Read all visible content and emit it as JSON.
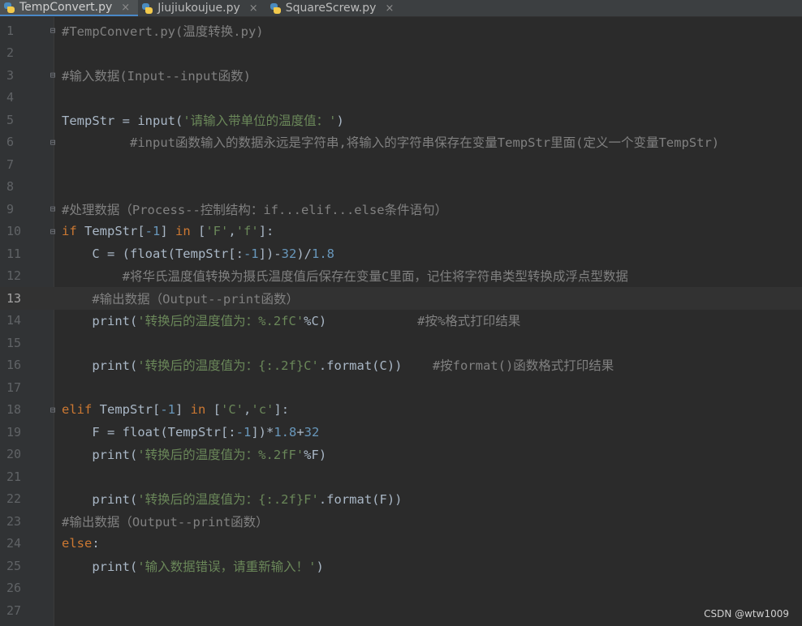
{
  "tabs": [
    {
      "label": "TempConvert.py",
      "active": true
    },
    {
      "label": "Jiujiukoujue.py",
      "active": false
    },
    {
      "label": "SquareScrew.py",
      "active": false
    }
  ],
  "close_glyph": "×",
  "current_line": 13,
  "lines": [
    {
      "n": "1",
      "fold": "⊟",
      "tokens": [
        [
          "cm",
          "#TempConvert.py(温度转换.py)"
        ]
      ]
    },
    {
      "n": "2",
      "fold": "",
      "tokens": []
    },
    {
      "n": "3",
      "fold": "⊟",
      "tokens": [
        [
          "cm",
          "#输入数据(Input--input函数)"
        ]
      ]
    },
    {
      "n": "4",
      "fold": "",
      "tokens": []
    },
    {
      "n": "5",
      "fold": "",
      "tokens": [
        [
          "tx",
          "TempStr = input("
        ],
        [
          "st",
          "'请输入带单位的温度值：'"
        ],
        [
          "tx",
          ")"
        ]
      ]
    },
    {
      "n": "6",
      "fold": "⊟",
      "tokens": [
        [
          "cm",
          "         #input函数输入的数据永远是字符串,将输入的字符串保存在变量TempStr里面(定义一个变量TempStr)"
        ]
      ]
    },
    {
      "n": "7",
      "fold": "",
      "tokens": []
    },
    {
      "n": "8",
      "fold": "",
      "tokens": []
    },
    {
      "n": "9",
      "fold": "⊟",
      "tokens": [
        [
          "cm",
          "#处理数据（Process--控制结构：if...elif...else条件语句）"
        ]
      ]
    },
    {
      "n": "10",
      "fold": "⊟",
      "tokens": [
        [
          "kw",
          "if "
        ],
        [
          "tx",
          "TempStr["
        ],
        [
          "nm",
          "-1"
        ],
        [
          "tx",
          "] "
        ],
        [
          "kw",
          "in "
        ],
        [
          "tx",
          "["
        ],
        [
          "st",
          "'F'"
        ],
        [
          "tx",
          ","
        ],
        [
          "st",
          "'f'"
        ],
        [
          "tx",
          "]:"
        ]
      ]
    },
    {
      "n": "11",
      "fold": "",
      "tokens": [
        [
          "tx",
          "    C = (float(TempStr[:"
        ],
        [
          "nm",
          "-1"
        ],
        [
          "tx",
          "])-"
        ],
        [
          "nm",
          "32"
        ],
        [
          "tx",
          ")/"
        ],
        [
          "nm",
          "1.8"
        ]
      ]
    },
    {
      "n": "12",
      "fold": "",
      "tokens": [
        [
          "cm",
          "        #将华氏温度值转换为摄氏温度值后保存在变量C里面，记住将字符串类型转换成浮点型数据"
        ]
      ]
    },
    {
      "n": "13",
      "fold": "",
      "tokens": [
        [
          "cm",
          "    #输出数据（Output--print函数）"
        ]
      ]
    },
    {
      "n": "14",
      "fold": "",
      "tokens": [
        [
          "tx",
          "    print("
        ],
        [
          "st",
          "'转换后的温度值为：%.2fC'"
        ],
        [
          "tx",
          "%C)            "
        ],
        [
          "cm",
          "#按%格式打印结果"
        ]
      ]
    },
    {
      "n": "15",
      "fold": "",
      "tokens": []
    },
    {
      "n": "16",
      "fold": "",
      "tokens": [
        [
          "tx",
          "    print("
        ],
        [
          "st",
          "'转换后的温度值为：{:.2f}C'"
        ],
        [
          "tx",
          ".format(C))    "
        ],
        [
          "cm",
          "#按format()函数格式打印结果"
        ]
      ]
    },
    {
      "n": "17",
      "fold": "",
      "tokens": []
    },
    {
      "n": "18",
      "fold": "⊟",
      "tokens": [
        [
          "kw",
          "elif "
        ],
        [
          "tx",
          "TempStr["
        ],
        [
          "nm",
          "-1"
        ],
        [
          "tx",
          "] "
        ],
        [
          "kw",
          "in "
        ],
        [
          "tx",
          "["
        ],
        [
          "st",
          "'C'"
        ],
        [
          "tx",
          ","
        ],
        [
          "st",
          "'c'"
        ],
        [
          "tx",
          "]:"
        ]
      ]
    },
    {
      "n": "19",
      "fold": "",
      "tokens": [
        [
          "tx",
          "    F = float(TempStr[:"
        ],
        [
          "nm",
          "-1"
        ],
        [
          "tx",
          "])*"
        ],
        [
          "nm",
          "1.8"
        ],
        [
          "tx",
          "+"
        ],
        [
          "nm",
          "32"
        ]
      ]
    },
    {
      "n": "20",
      "fold": "",
      "tokens": [
        [
          "tx",
          "    print("
        ],
        [
          "st",
          "'转换后的温度值为：%.2fF'"
        ],
        [
          "tx",
          "%F)"
        ]
      ]
    },
    {
      "n": "21",
      "fold": "",
      "tokens": []
    },
    {
      "n": "22",
      "fold": "",
      "tokens": [
        [
          "tx",
          "    print("
        ],
        [
          "st",
          "'转换后的温度值为：{:.2f}F'"
        ],
        [
          "tx",
          ".format(F))"
        ]
      ]
    },
    {
      "n": "23",
      "fold": "",
      "tokens": [
        [
          "cm",
          "#输出数据（Output--print函数）"
        ]
      ]
    },
    {
      "n": "24",
      "fold": "",
      "tokens": [
        [
          "kw",
          "else"
        ],
        [
          "tx",
          ":"
        ]
      ]
    },
    {
      "n": "25",
      "fold": "",
      "tokens": [
        [
          "tx",
          "    print("
        ],
        [
          "st",
          "'输入数据错误，请重新输入！'"
        ],
        [
          "tx",
          ")"
        ]
      ]
    },
    {
      "n": "26",
      "fold": "",
      "tokens": []
    },
    {
      "n": "27",
      "fold": "",
      "tokens": []
    }
  ],
  "watermark": "CSDN @wtw1009",
  "colors": {
    "background": "#2b2b2b",
    "comment": "#808080",
    "keyword": "#cc7832",
    "string": "#6a8759",
    "number": "#6897bb",
    "text": "#a9b7c6"
  }
}
